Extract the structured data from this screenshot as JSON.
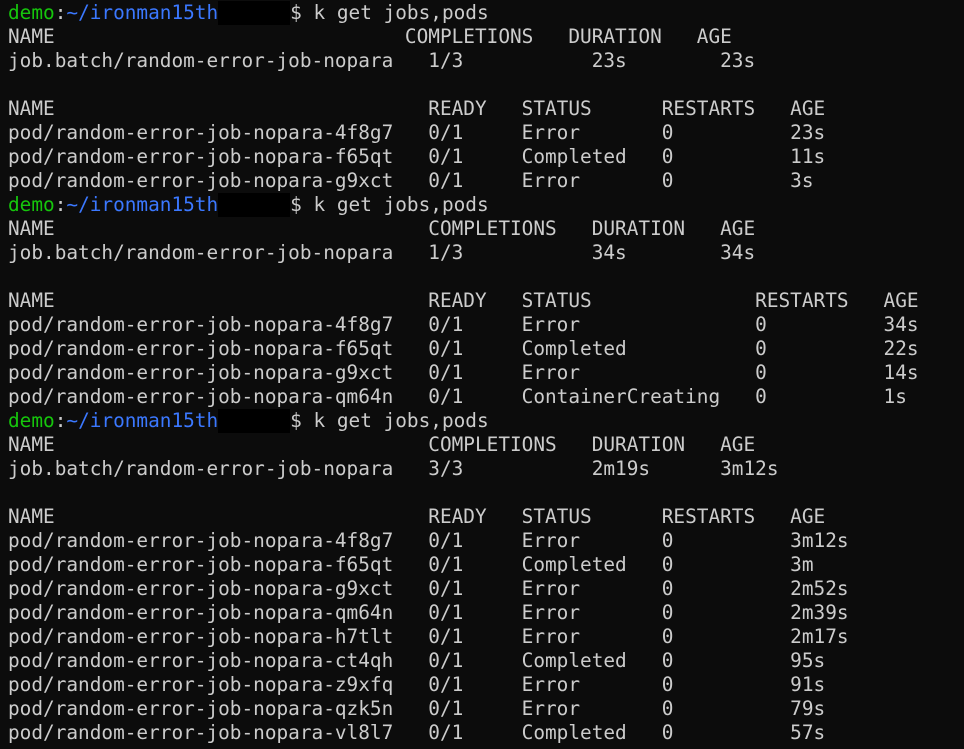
{
  "window": {
    "background": "#0c0c0c",
    "foreground": "#cccccc",
    "prompt_user_color": "#16c60c",
    "prompt_path_color": "#3b78ff"
  },
  "blocks": [
    {
      "prompt": {
        "user": "demo",
        "separator": ":",
        "path": "~/ironman15th",
        "symbol": "$",
        "command": "k get jobs,pods"
      },
      "lines": [
        "NAME                              COMPLETIONS   DURATION   AGE",
        "job.batch/random-error-job-nopara   1/3           23s        23s",
        "",
        "NAME                                READY   STATUS      RESTARTS   AGE",
        "pod/random-error-job-nopara-4f8g7   0/1     Error       0          23s",
        "pod/random-error-job-nopara-f65qt   0/1     Completed   0          11s",
        "pod/random-error-job-nopara-g9xct   0/1     Error       0          3s"
      ]
    },
    {
      "prompt": {
        "user": "demo",
        "separator": ":",
        "path": "~/ironman15th",
        "symbol": "$",
        "command": "k get jobs,pods"
      },
      "lines": [
        "NAME                                COMPLETIONS   DURATION   AGE",
        "job.batch/random-error-job-nopara   1/3           34s        34s",
        "",
        "NAME                                READY   STATUS              RESTARTS   AGE",
        "pod/random-error-job-nopara-4f8g7   0/1     Error               0          34s",
        "pod/random-error-job-nopara-f65qt   0/1     Completed           0          22s",
        "pod/random-error-job-nopara-g9xct   0/1     Error               0          14s",
        "pod/random-error-job-nopara-qm64n   0/1     ContainerCreating   0          1s"
      ]
    },
    {
      "prompt": {
        "user": "demo",
        "separator": ":",
        "path": "~/ironman15th",
        "symbol": "$",
        "command": "k get jobs,pods"
      },
      "lines": [
        "NAME                                COMPLETIONS   DURATION   AGE",
        "job.batch/random-error-job-nopara   3/3           2m19s      3m12s",
        "",
        "NAME                                READY   STATUS      RESTARTS   AGE",
        "pod/random-error-job-nopara-4f8g7   0/1     Error       0          3m12s",
        "pod/random-error-job-nopara-f65qt   0/1     Completed   0          3m",
        "pod/random-error-job-nopara-g9xct   0/1     Error       0          2m52s",
        "pod/random-error-job-nopara-qm64n   0/1     Error       0          2m39s",
        "pod/random-error-job-nopara-h7tlt   0/1     Error       0          2m17s",
        "pod/random-error-job-nopara-ct4qh   0/1     Completed   0          95s",
        "pod/random-error-job-nopara-z9xfq   0/1     Error       0          91s",
        "pod/random-error-job-nopara-qzk5n   0/1     Error       0          79s",
        "pod/random-error-job-nopara-vl8l7   0/1     Completed   0          57s"
      ]
    }
  ]
}
